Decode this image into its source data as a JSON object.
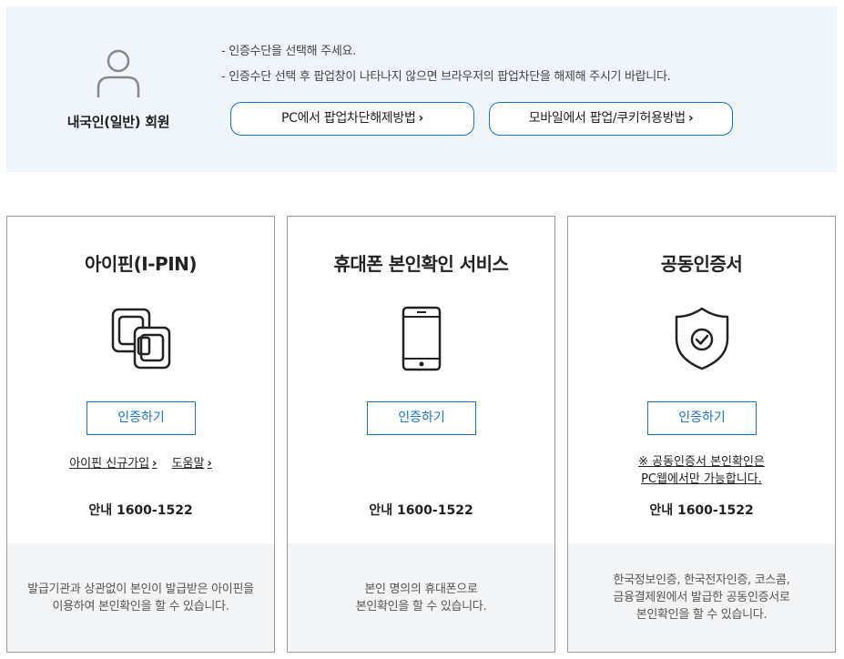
{
  "member": {
    "label": "내국인(일반) 회원",
    "icon": "user-icon"
  },
  "notice": {
    "line1": "- 인증수단을 선택해 주세요.",
    "line2": "- 인증수단 선택 후 팝업창이 나타나지 않으면 브라우저의 팝업차단을 해제해 주시기 바랍니다."
  },
  "help_buttons": {
    "pc": "PC에서 팝업차단해제방법",
    "mobile": "모바일에서 팝업/쿠키허용방법",
    "chevron": "›"
  },
  "cards": {
    "ipin": {
      "title": "아이핀(I-PIN)",
      "icon": "ipin-icon",
      "button": "인증하기",
      "signup_link": "아이핀 신규가입",
      "help_link": "도움말",
      "phone": "안내 1600-1522",
      "description_line1": "발급기관과 상관없이 본인이 발급받은 아이핀을",
      "description_line2": "이용하여 본인확인을 할 수 있습니다."
    },
    "mobile": {
      "title": "휴대폰 본인확인 서비스",
      "icon": "smartphone-icon",
      "button": "인증하기",
      "phone": "안내 1600-1522",
      "description_line1": "본인 명의의 휴대폰으로",
      "description_line2": "본인확인을 할 수 있습니다."
    },
    "certificate": {
      "title": "공동인증서",
      "icon": "shield-check-icon",
      "button": "인증하기",
      "note_line1": "※ 공동인증서 본인확인은",
      "note_line2": "PC웹에서만 가능합니다.",
      "phone": "안내 1600-1522",
      "description_line1": "한국정보인증, 한국전자인증, 코스콤,",
      "description_line2": "금융결제원에서 발급한 공동인증서로",
      "description_line3": "본인확인을 할 수 있습니다."
    }
  },
  "colors": {
    "accent": "#1a73c7",
    "panel_bg": "#f0f4fb",
    "footer_bg": "#f3f4f6"
  }
}
